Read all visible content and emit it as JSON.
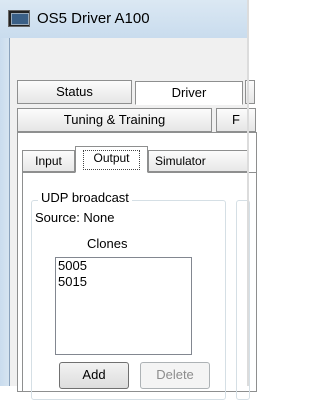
{
  "window": {
    "title": "OS5 Driver A100"
  },
  "tabs": {
    "row1": [
      {
        "label": "Status"
      },
      {
        "label": "Driver"
      }
    ],
    "row2": [
      {
        "label": "Tuning & Training"
      },
      {
        "label": "F"
      }
    ],
    "selected": "Driver"
  },
  "subtabs": {
    "items": [
      {
        "label": "Input"
      },
      {
        "label": "Output"
      },
      {
        "label": "Simulator"
      }
    ],
    "selected": "Output"
  },
  "udp": {
    "legend": "UDP broadcast",
    "source": "Source: None",
    "clones_label": "Clones",
    "clones": [
      "5005",
      "5015"
    ],
    "add_label": "Add",
    "delete_label": "Delete"
  }
}
